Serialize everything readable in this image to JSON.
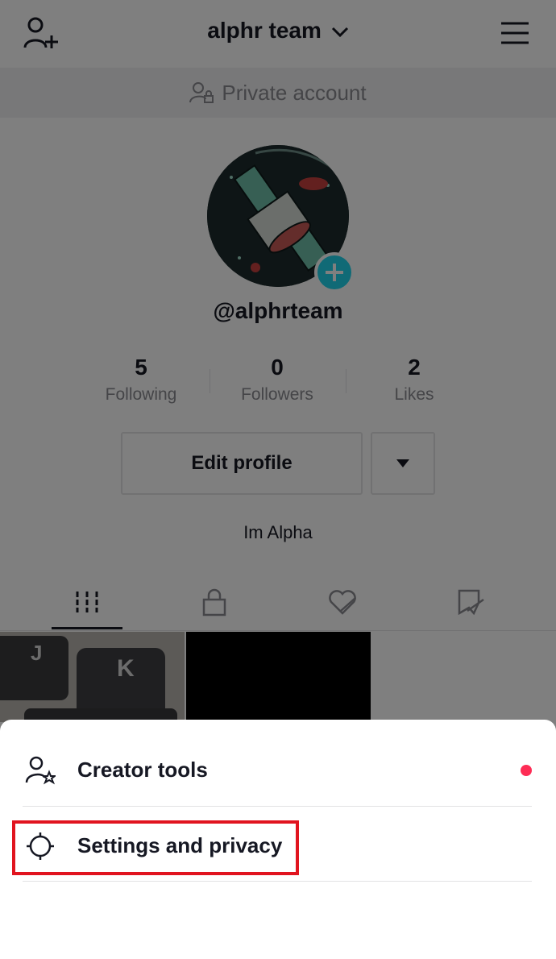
{
  "header": {
    "username": "alphr team"
  },
  "private_banner": {
    "text": "Private account"
  },
  "profile": {
    "handle": "@alphrteam",
    "bio": "Im Alpha"
  },
  "stats": [
    {
      "value": "5",
      "label": "Following"
    },
    {
      "value": "0",
      "label": "Followers"
    },
    {
      "value": "2",
      "label": "Likes"
    }
  ],
  "buttons": {
    "edit_profile": "Edit profile"
  },
  "sheet": {
    "items": [
      {
        "label": "Creator tools",
        "icon": "creator-tools-icon"
      },
      {
        "label": "Settings and privacy",
        "icon": "settings-gear-icon"
      }
    ]
  },
  "colors": {
    "accent": "#fe2c55",
    "highlight": "#e1141f",
    "avatar_badge": "#20d5ec"
  }
}
